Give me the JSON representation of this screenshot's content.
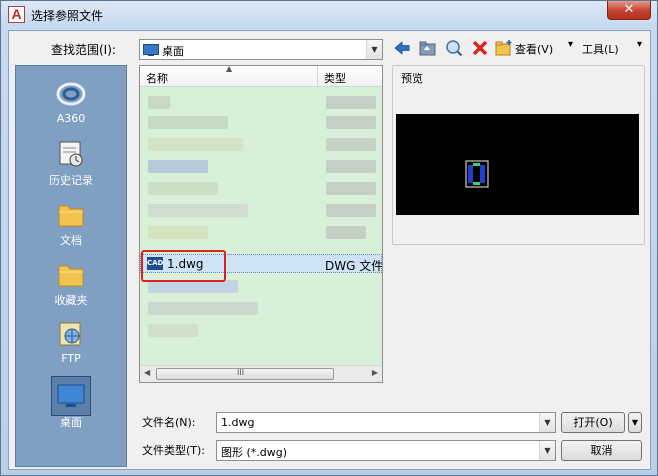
{
  "window": {
    "title": "选择参照文件",
    "close_glyph": "✕"
  },
  "lookin": {
    "label": "查找范围(I):",
    "value": "桌面"
  },
  "toolbar": {
    "views_label": "查看(V)",
    "tools_label": "工具(L)"
  },
  "places": [
    {
      "label": "A360",
      "icon": "a360-icon"
    },
    {
      "label": "历史记录",
      "icon": "history-icon"
    },
    {
      "label": "文档",
      "icon": "folder-icon"
    },
    {
      "label": "收藏夹",
      "icon": "favorites-folder-icon"
    },
    {
      "label": "FTP",
      "icon": "ftp-icon"
    },
    {
      "label": "桌面",
      "icon": "desktop-icon"
    }
  ],
  "filelist": {
    "columns": [
      "名称",
      "类型"
    ],
    "selected_file": {
      "name": "1.dwg",
      "type": "DWG 文件",
      "icon_text": "CAD"
    },
    "scroll_glyph": "III"
  },
  "preview": {
    "label": "预览"
  },
  "filename": {
    "label": "文件名(N):",
    "value": "1.dwg"
  },
  "filetype": {
    "label": "文件类型(T):",
    "value": "图形 (*.dwg)"
  },
  "buttons": {
    "open": "打开(O)",
    "cancel": "取消"
  },
  "colors": {
    "list_bg": "#d8f0d8",
    "places_bg": "#7f9fc3",
    "highlight": "#e02020"
  }
}
